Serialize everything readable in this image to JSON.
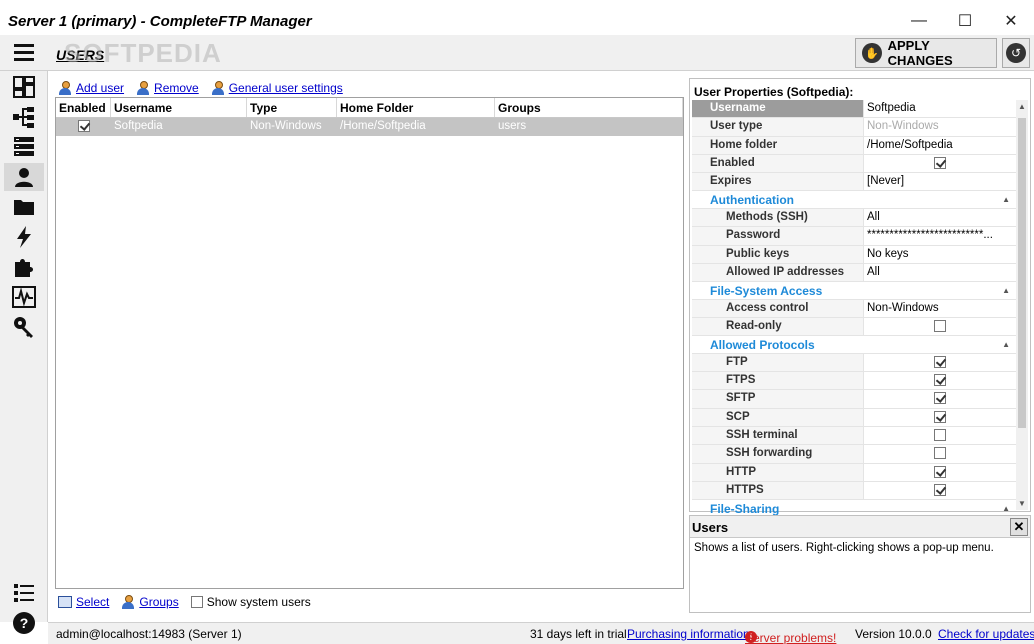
{
  "window": {
    "title": "Server 1 (primary) - CompleteFTP Manager",
    "minimize": "—",
    "maximize": "☐",
    "close": "✕"
  },
  "watermark": "SOFTPEDIA",
  "toolbar": {
    "section_title": "USERS",
    "apply_label": "APPLY CHANGES"
  },
  "sidebar": {
    "items": [
      {
        "name": "dashboard-icon"
      },
      {
        "name": "cluster-icon"
      },
      {
        "name": "servers-icon"
      },
      {
        "name": "users-icon",
        "active": true
      },
      {
        "name": "folders-icon"
      },
      {
        "name": "events-icon"
      },
      {
        "name": "extensions-icon"
      },
      {
        "name": "monitoring-icon"
      },
      {
        "name": "security-icon"
      }
    ],
    "bottom": [
      {
        "name": "log-icon"
      },
      {
        "name": "help-icon"
      }
    ]
  },
  "actions": {
    "add_user": "Add user",
    "remove": "Remove",
    "general_settings": "General user settings"
  },
  "grid": {
    "columns": [
      "Enabled",
      "Username",
      "Type",
      "Home Folder",
      "Groups"
    ],
    "rows": [
      {
        "enabled": true,
        "username": "Softpedia",
        "type": "Non-Windows",
        "home_folder": "/Home/Softpedia",
        "groups": "users"
      }
    ]
  },
  "bottom": {
    "select": "Select",
    "groups": "Groups",
    "show_system_users": "Show system users"
  },
  "properties": {
    "title": "User Properties (Softpedia):",
    "general": [
      {
        "key": "Username",
        "value": "Softpedia"
      },
      {
        "key": "User type",
        "value": "Non-Windows"
      },
      {
        "key": "Home folder",
        "value": "/Home/Softpedia"
      },
      {
        "key": "Enabled",
        "value": ""
      },
      {
        "key": "Expires",
        "value": "[Never]"
      }
    ],
    "authentication": {
      "label": "Authentication",
      "rows": [
        {
          "key": "Methods (SSH)",
          "value": "All"
        },
        {
          "key": "Password",
          "value": "**************************..."
        },
        {
          "key": "Public keys",
          "value": "No keys"
        },
        {
          "key": "Allowed IP addresses",
          "value": "All"
        }
      ]
    },
    "filesystem": {
      "label": "File-System Access",
      "rows": [
        {
          "key": "Access control",
          "value": "Non-Windows"
        },
        {
          "key": "Read-only",
          "value": ""
        }
      ]
    },
    "protocols": {
      "label": "Allowed Protocols",
      "rows": [
        {
          "key": "FTP",
          "checked": true
        },
        {
          "key": "FTPS",
          "checked": true
        },
        {
          "key": "SFTP",
          "checked": true
        },
        {
          "key": "SCP",
          "checked": true
        },
        {
          "key": "SSH terminal",
          "checked": false
        },
        {
          "key": "SSH forwarding",
          "checked": false
        },
        {
          "key": "HTTP",
          "checked": true
        },
        {
          "key": "HTTPS",
          "checked": true
        }
      ]
    },
    "sharing": {
      "label": "File-Sharing"
    }
  },
  "help": {
    "title": "Users",
    "close": "✕",
    "body": "Shows a list of users.  Right-clicking shows a pop-up menu."
  },
  "status": {
    "connection": "admin@localhost:14983 (Server 1)",
    "trial": "31 days left in trial",
    "purchasing": "Purchasing information",
    "problems": "Server problems!",
    "version": "Version 10.0.0",
    "updates": "Check for updates"
  }
}
